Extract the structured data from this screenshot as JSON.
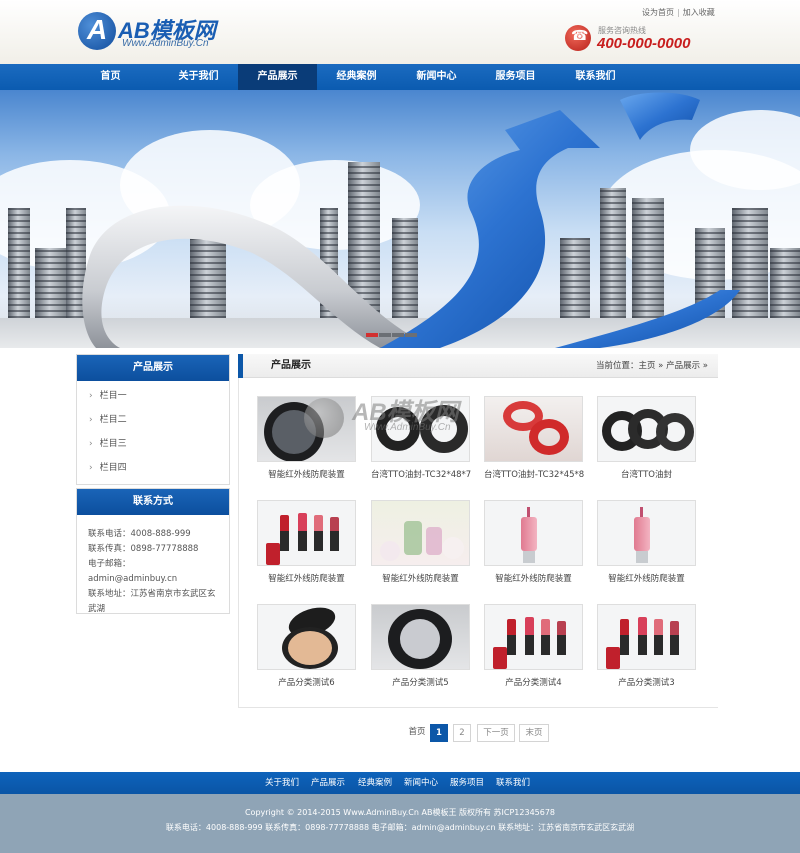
{
  "header": {
    "logo_title": "AB模板网",
    "logo_sub": "Www.AdminBuy.Cn",
    "top_links": [
      "设为首页",
      "加入收藏"
    ],
    "hotline_label": "服务咨询热线",
    "hotline": "400-000-0000"
  },
  "nav": {
    "items": [
      "首页",
      "关于我们",
      "产品展示",
      "经典案例",
      "新闻中心",
      "服务项目",
      "联系我们"
    ],
    "active_index": 2
  },
  "sidebar": {
    "products_title": "产品展示",
    "categories": [
      "栏目一",
      "栏目二",
      "栏目三",
      "栏目四"
    ],
    "contact_title": "联系方式",
    "contact": {
      "phone": "联系电话：4008-888-999",
      "fax": "联系传真：0898-77778888",
      "email": "电子邮箱：admin@adminbuy.cn",
      "address": "联系地址：江苏省南京市玄武区玄武湖"
    }
  },
  "main": {
    "section_title": "产品展示",
    "breadcrumb": {
      "prefix": "当前位置：",
      "home": "主页",
      "sep1": "»",
      "current": "产品展示",
      "sep2": "»"
    },
    "watermark": {
      "title": "AB模板网",
      "sub": "Www.AdminBuy.Cn"
    },
    "products": [
      {
        "name": "智能红外线防爬装置",
        "icon": "compact-powder-dark"
      },
      {
        "name": "台湾TTO油封-TC32*48*7",
        "icon": "oil-seal-rings"
      },
      {
        "name": "台湾TTO油封-TC32*45*8",
        "icon": "red-tape-rolls"
      },
      {
        "name": "台湾TTO油封",
        "icon": "oil-seal-rings"
      },
      {
        "name": "智能红外线防爬装置",
        "icon": "lipsticks"
      },
      {
        "name": "智能红外线防爬装置",
        "icon": "perfume-flowers"
      },
      {
        "name": "智能红外线防爬装置",
        "icon": "lip-gloss"
      },
      {
        "name": "智能红外线防爬装置",
        "icon": "lip-gloss"
      },
      {
        "name": "产品分类测试6",
        "icon": "compact-powder-beige"
      },
      {
        "name": "产品分类测试5",
        "icon": "compact-powder-dark"
      },
      {
        "name": "产品分类测试4",
        "icon": "lipsticks"
      },
      {
        "name": "产品分类测试3",
        "icon": "lipsticks"
      }
    ],
    "pager": {
      "first": "首页",
      "pages": [
        "1",
        "2"
      ],
      "current": "1",
      "next": "下一页",
      "last": "末页"
    }
  },
  "footer": {
    "links": [
      "关于我们",
      "产品展示",
      "经典案例",
      "新闻中心",
      "服务项目",
      "联系我们"
    ],
    "copyright": "Copyright © 2014-2015 Www.AdminBuy.Cn AB模板王 版权所有 苏ICP12345678",
    "contact_line": "联系电话：4008-888-999 联系传真：0898-77778888 电子邮箱：admin@adminbuy.cn 联系地址：江苏省南京市玄武区玄武湖"
  },
  "colors": {
    "brand_blue": "#0c57a8",
    "nav_active": "#0a3c78",
    "hotline_red": "#c81e1e",
    "footer_bg": "#8fa4b6"
  }
}
